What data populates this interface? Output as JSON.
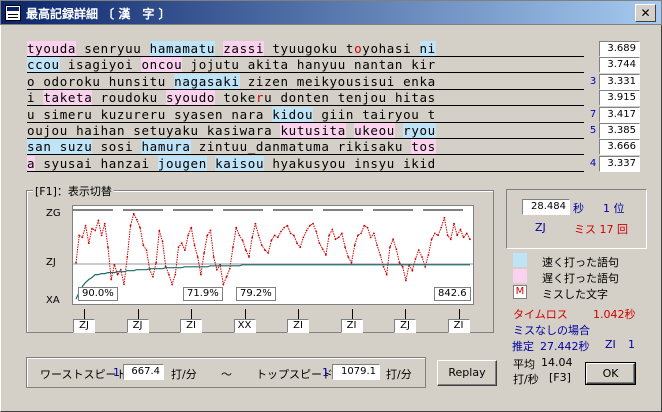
{
  "window": {
    "title": "最高記録詳細 〔 漢　字 〕",
    "close": "✕"
  },
  "lines": [
    {
      "segments": [
        {
          "t": "tyouda",
          "c": "slow"
        },
        {
          "t": " senryuu "
        },
        {
          "t": "hamamatu",
          "c": "fast"
        },
        {
          "t": " "
        },
        {
          "t": "zassi",
          "c": "slow"
        },
        {
          "t": " tyuugoku t"
        },
        {
          "t": "o",
          "c": "miss"
        },
        {
          "t": "yohasi "
        },
        {
          "t": "ni",
          "c": "fast"
        }
      ],
      "value": "3.689",
      "mark": ""
    },
    {
      "segments": [
        {
          "t": "ccou",
          "c": "fast"
        },
        {
          "t": " isagiyoi "
        },
        {
          "t": "oncou",
          "c": "slow"
        },
        {
          "t": " jojutu akita hanyuu nantan kir"
        }
      ],
      "value": "3.744",
      "mark": ""
    },
    {
      "segments": [
        {
          "t": "o odoroku hunsitu "
        },
        {
          "t": "nagasaki",
          "c": "fast"
        },
        {
          "t": " zizen meikyousisui enka"
        }
      ],
      "value": "3.331",
      "mark": "3"
    },
    {
      "segments": [
        {
          "t": "i "
        },
        {
          "t": "taketa",
          "c": "slow"
        },
        {
          "t": " roudoku "
        },
        {
          "t": "syoudo",
          "c": "slow"
        },
        {
          "t": " toke"
        },
        {
          "t": "r",
          "c": "miss"
        },
        {
          "t": "u donten tenjou hitas"
        }
      ],
      "value": "3.915",
      "mark": ""
    },
    {
      "segments": [
        {
          "t": "u simeru kuzureru syasen nara "
        },
        {
          "t": "kidou",
          "c": "fast"
        },
        {
          "t": " giin tairyou t"
        }
      ],
      "value": "3.417",
      "mark": "7"
    },
    {
      "segments": [
        {
          "t": "o"
        },
        {
          "t": "ujou haihan setuyaku kasiwara "
        },
        {
          "t": "kutusita",
          "c": "slow"
        },
        {
          "t": " "
        },
        {
          "t": "ukeou",
          "c": "slow"
        },
        {
          "t": " "
        },
        {
          "t": "ryou",
          "c": "fast"
        }
      ],
      "value": "3.385",
      "mark": "5"
    },
    {
      "segments": [
        {
          "t": "san suzu",
          "c": "fast"
        },
        {
          "t": " sosi "
        },
        {
          "t": "hamura",
          "c": "fast"
        },
        {
          "t": " zintuu_danmatuma rikisaku "
        },
        {
          "t": "tos",
          "c": "slow"
        }
      ],
      "value": "3.666",
      "mark": ""
    },
    {
      "segments": [
        {
          "t": "a",
          "c": "slow"
        },
        {
          "t": " syusai hanzai "
        },
        {
          "t": "jougen",
          "c": "fast"
        },
        {
          "t": " "
        },
        {
          "t": "kaisou",
          "c": "fast"
        },
        {
          "t": " hyakusyou insyu ikid"
        }
      ],
      "value": "3.337",
      "mark": "4"
    }
  ],
  "group_label": "[F1]：表示切替",
  "y_labels": {
    "top": "ZG",
    "mid": "ZJ",
    "bottom": "XA"
  },
  "pct_labels": [
    "90.0%",
    "71.9%",
    "79.2%",
    "842.6"
  ],
  "categories": [
    "ZJ",
    "ZJ",
    "ZI",
    "XX",
    "ZI",
    "ZI",
    "ZJ",
    "ZI"
  ],
  "stats": {
    "seconds": "28.484",
    "sec_unit": "秒",
    "rank": "1 位",
    "rank_label": "ZJ",
    "miss_label": "ミス 17 回"
  },
  "legend": {
    "fast": "速く打った語句",
    "slow": "遅く打った語句",
    "miss_sym": "M",
    "miss": "ミスした文字"
  },
  "timeloss": {
    "label": "タイムロス",
    "value": "1.042秒"
  },
  "nomiss": {
    "label": "ミスなしの場合",
    "est": "推定",
    "value": "27.442秒",
    "rank": "ZI",
    "rank_num": "1"
  },
  "avg": {
    "label": "平均",
    "value": "14.04",
    "unit": "打/秒",
    "key": "[F3]"
  },
  "worst": {
    "label": "ワーストスピード",
    "n": "1",
    "value": "667.4",
    "unit": "打/分"
  },
  "tilde": "〜",
  "best": {
    "label": "トップスピード",
    "n": "1",
    "value": "1079.1",
    "unit": "打/分"
  },
  "buttons": {
    "replay": "Replay",
    "ok": "OK"
  },
  "colors": {
    "fast": "#bfe3f7",
    "slow": "#fbd2ee",
    "miss": "#d00000",
    "line": "#d00000",
    "avg": "#1e6a6a"
  },
  "chart_data": {
    "type": "line",
    "series": [
      {
        "values": [
          42,
          70,
          68,
          80,
          62,
          77,
          75,
          85,
          70,
          82,
          58,
          25,
          40,
          30,
          35,
          20,
          48,
          80,
          92,
          86,
          78,
          60,
          55,
          35,
          28,
          42,
          75,
          64,
          38,
          30,
          20,
          30,
          58,
          62,
          55,
          70,
          78,
          60,
          48,
          30,
          52,
          70,
          75,
          48,
          35,
          40,
          20,
          28,
          36,
          58,
          78,
          70,
          65,
          55,
          48,
          68,
          82,
          70,
          60,
          55,
          52,
          65,
          70,
          68,
          74,
          78,
          80,
          72,
          70,
          62,
          58,
          68,
          75,
          80,
          82,
          74,
          62,
          56,
          50,
          70,
          76,
          66,
          68,
          72,
          58,
          48,
          42,
          60,
          70,
          72,
          80,
          78,
          68,
          72,
          60,
          50,
          38,
          30,
          58,
          66,
          56,
          42,
          38,
          24,
          40,
          34,
          46,
          55,
          48,
          38,
          50,
          66,
          72,
          70,
          78,
          88,
          70,
          66,
          82,
          70,
          76,
          68,
          72,
          66
        ]
      },
      {
        "values": [
          5,
          12,
          18,
          22,
          25,
          27,
          30,
          30,
          31,
          31,
          32,
          32,
          32,
          33,
          33,
          33,
          34,
          34,
          34,
          35,
          35,
          35,
          35,
          36,
          36,
          36,
          36,
          36,
          37,
          37,
          37,
          37,
          37,
          37,
          38,
          38,
          38,
          38,
          38,
          38,
          38,
          38,
          39,
          39,
          39,
          39,
          39,
          39,
          39,
          39,
          39,
          39,
          40,
          40,
          40,
          40,
          40,
          40,
          40,
          40,
          40,
          40,
          40,
          40,
          40,
          40,
          40,
          40,
          40,
          40,
          40,
          40,
          40,
          40,
          40,
          40,
          40,
          40,
          40,
          40,
          40,
          40,
          40,
          40,
          40,
          40,
          40,
          40,
          40,
          40,
          40,
          40,
          40,
          40,
          40,
          40,
          40,
          40,
          40,
          40,
          40,
          40,
          40,
          40,
          40,
          40,
          40,
          40,
          40,
          40,
          40,
          40,
          40,
          40,
          40,
          40,
          40,
          40,
          40,
          40,
          40,
          40,
          40,
          40
        ]
      }
    ],
    "ylim": [
      0,
      100
    ]
  }
}
